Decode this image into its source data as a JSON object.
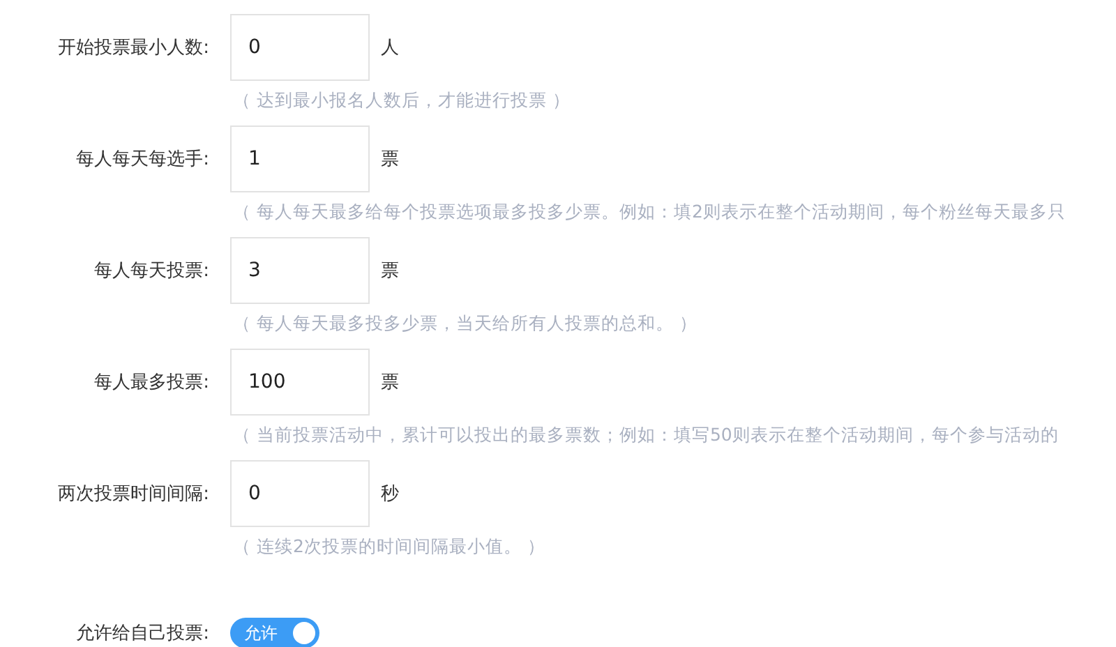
{
  "fields": [
    {
      "label": "开始投票最小人数:",
      "value": "0",
      "unit": "人",
      "hint": "（ 达到最小报名人数后，才能进行投票 ）"
    },
    {
      "label": "每人每天每选手:",
      "value": "1",
      "unit": "票",
      "hint": "（ 每人每天最多给每个投票选项最多投多少票。例如：填2则表示在整个活动期间，每个粉丝每天最多只"
    },
    {
      "label": "每人每天投票:",
      "value": "3",
      "unit": "票",
      "hint": "（ 每人每天最多投多少票，当天给所有人投票的总和。 ）"
    },
    {
      "label": "每人最多投票:",
      "value": "100",
      "unit": "票",
      "hint": "（ 当前投票活动中，累计可以投出的最多票数；例如：填写50则表示在整个活动期间，每个参与活动的"
    },
    {
      "label": "两次投票时间间隔:",
      "value": "0",
      "unit": "秒",
      "hint": "（ 连续2次投票的时间间隔最小值。 ）"
    }
  ],
  "toggle": {
    "label": "允许给自己投票:",
    "text": "允许",
    "on": true
  }
}
